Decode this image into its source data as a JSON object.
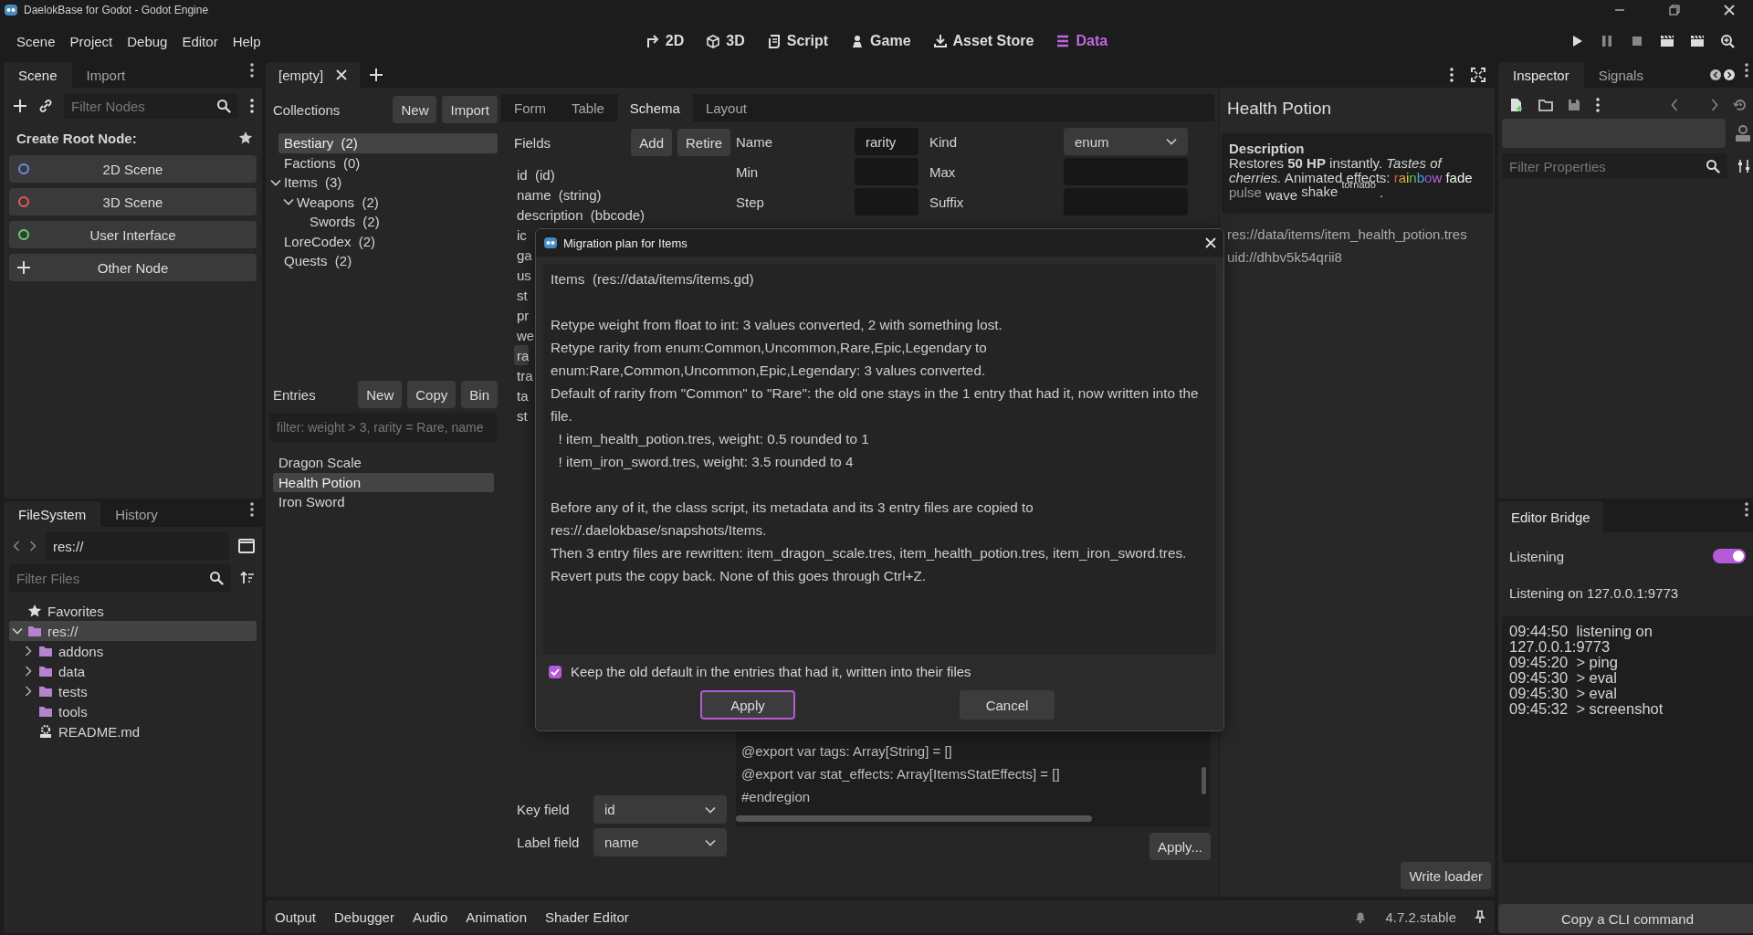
{
  "window": {
    "title": "DaelokBase for Godot - Godot Engine"
  },
  "menu": [
    "Scene",
    "Project",
    "Debug",
    "Editor",
    "Help"
  ],
  "workspaces": [
    {
      "label": "2D",
      "kind": "planar",
      "selected": false
    },
    {
      "label": "3D",
      "kind": "spatial",
      "selected": false
    },
    {
      "label": "Script",
      "kind": "script",
      "selected": false
    },
    {
      "label": "Game",
      "kind": "game",
      "selected": false
    },
    {
      "label": "Asset Store",
      "kind": "store",
      "selected": false
    },
    {
      "label": "Data",
      "kind": "data",
      "selected": true
    }
  ],
  "scene_dock": {
    "tabs": [
      {
        "label": "Scene",
        "selected": true
      },
      {
        "label": "Import",
        "selected": false
      }
    ],
    "filter": {
      "placeholder": "Filter Nodes"
    },
    "heading": "Create Root Node:",
    "buttons": [
      {
        "label": "2D Scene",
        "kind": "planar"
      },
      {
        "label": "3D Scene",
        "kind": "spatial"
      },
      {
        "label": "User Interface",
        "kind": "ui"
      },
      {
        "label": "Other Node",
        "kind": "other"
      }
    ]
  },
  "filesystem_dock": {
    "tabs": [
      {
        "label": "FileSystem",
        "selected": true
      },
      {
        "label": "History",
        "selected": false
      }
    ],
    "path": "res://",
    "filter": {
      "placeholder": "Filter Files"
    },
    "tree": [
      {
        "label": "Favorites",
        "kind": "favorites",
        "selected": false
      },
      {
        "label": "res://",
        "kind": "folder",
        "selected": true,
        "expanded": true,
        "children": [
          {
            "label": "addons",
            "kind": "folder",
            "selected": false,
            "expanded": false
          },
          {
            "label": "data",
            "kind": "folder",
            "selected": false,
            "expanded": false
          },
          {
            "label": "tests",
            "kind": "folder",
            "selected": false,
            "expanded": false
          },
          {
            "label": "tools",
            "kind": "folder",
            "selected": false
          },
          {
            "label": "README.md",
            "kind": "file",
            "selected": false
          }
        ]
      }
    ]
  },
  "scene_tabs": [
    "[empty]"
  ],
  "collections": {
    "title": "Collections",
    "buttons": [
      "New",
      "Import"
    ],
    "tree": [
      {
        "label": "Bestiary  (2)",
        "selected": true
      },
      {
        "label": "Factions  (0)",
        "selected": false
      },
      {
        "label": "Items  (3)",
        "selected": false,
        "expanded": true,
        "children": [
          {
            "label": "Weapons  (2)",
            "selected": false,
            "expanded": true,
            "children": [
              {
                "label": "Swords  (2)",
                "selected": false
              }
            ]
          }
        ]
      },
      {
        "label": "LoreCodex  (2)",
        "selected": false
      },
      {
        "label": "Quests  (2)",
        "selected": false
      }
    ]
  },
  "entries": {
    "title": "Entries",
    "buttons": [
      "New",
      "Copy",
      "Bin"
    ],
    "filter": {
      "placeholder": "filter: weight > 3, rarity = Rare, name"
    },
    "items": [
      {
        "label": "Dragon Scale",
        "selected": false
      },
      {
        "label": "Health Potion",
        "selected": true
      },
      {
        "label": "Iron Sword",
        "selected": false
      }
    ]
  },
  "schema": {
    "tabs": [
      {
        "label": "Form",
        "selected": false
      },
      {
        "label": "Table",
        "selected": false
      },
      {
        "label": "Schema",
        "selected": true
      },
      {
        "label": "Layout",
        "selected": false
      }
    ],
    "fields_title": "Fields",
    "buttons": [
      "Add",
      "Retire"
    ],
    "fields": [
      {
        "label": "id  (id)",
        "selected": false
      },
      {
        "label": "name  (string)",
        "selected": false
      },
      {
        "label": "description  (bbcode)",
        "selected": false
      },
      {
        "label": "ic",
        "selected": false
      },
      {
        "label": "ga",
        "selected": false
      },
      {
        "label": "us",
        "selected": false
      },
      {
        "label": "st",
        "selected": false
      },
      {
        "label": "pr",
        "selected": false
      },
      {
        "label": "we",
        "selected": false
      },
      {
        "label": "ra",
        "selected": true
      },
      {
        "label": "tra",
        "selected": false
      },
      {
        "label": "ta",
        "selected": false
      },
      {
        "label": "st",
        "selected": false
      }
    ],
    "properties": [
      {
        "label": "Name",
        "kind": "text",
        "value": "rarity"
      },
      {
        "label": "Kind",
        "kind": "select",
        "value": "enum"
      },
      {
        "label": "Min",
        "kind": "text"
      },
      {
        "label": "Max",
        "kind": "text"
      },
      {
        "label": "Step",
        "kind": "text"
      },
      {
        "label": "Suffix",
        "kind": "text"
      }
    ],
    "code": [
      "@export var tags: Array[String] = []",
      "@export var stat_effects: Array[ItemsStatEffects] = []",
      "#endregion"
    ],
    "key_field": {
      "label": "Key field",
      "value": "id"
    },
    "label_field": {
      "label": "Label field",
      "value": "name"
    },
    "apply_button": "Apply..."
  },
  "preview": {
    "title": "Health Potion",
    "description_label": "Description",
    "description": "Restores **50 HP** instantly. *Tastes of cherries.* Animated effects: ",
    "effects": [
      {
        "text": "rainbow",
        "kind": "rainbow"
      },
      {
        "text": "fade",
        "kind": "fade"
      },
      {
        "text": "pulse",
        "kind": "pulse"
      },
      {
        "text": "wave",
        "kind": "wave"
      },
      {
        "text": "shake",
        "kind": "shake"
      },
      {
        "text": "tornado",
        "kind": "tornado"
      }
    ],
    "description_end": ".",
    "path": "res://data/items/item_health_potion.tres",
    "uid": "uid://dhbv5k54qrii8",
    "write_loader_button": "Write loader"
  },
  "bottom_tabs": [
    "Output",
    "Debugger",
    "Audio",
    "Animation",
    "Shader Editor"
  ],
  "version": "4.7.2.stable",
  "inspector": {
    "tabs": [
      {
        "label": "Inspector",
        "selected": true
      },
      {
        "label": "Signals",
        "selected": false
      }
    ],
    "filter": {
      "placeholder": "Filter Properties"
    }
  },
  "bridge": {
    "tab": "Editor Bridge",
    "toggle": {
      "label": "Listening",
      "on": true
    },
    "status": "Listening on 127.0.0.1:9773",
    "log": [
      "09:44:50  listening on 127.0.0.1:9773",
      "09:45:20  > ping",
      "09:45:30  > eval",
      "09:45:30  > eval",
      "09:45:32  > screenshot"
    ],
    "button": "Copy a CLI command"
  },
  "dialog": {
    "title": "Migration plan for Items",
    "paragraphs": [
      [
        "Items  (res://data/items/items.gd)"
      ],
      [
        "Retype weight from float to int: 3 values converted, 2 with something lost.",
        "Retype rarity from enum:Common,Uncommon,Rare,Epic,Legendary to enum:Rare,Common,Uncommon,Epic,Legendary: 3 values converted.",
        "Default of rarity from \"Common\" to \"Rare\": the old one stays in the 1 entry that had it, now written into the file.",
        "  ! item_health_potion.tres, weight: 0.5 rounded to 1",
        "  ! item_iron_sword.tres, weight: 3.5 rounded to 4"
      ],
      [
        "Before any of it, the class script, its metadata and its 3 entry files are copied to res://.daelokbase/snapshots/Items.",
        "Then 3 entry files are rewritten: item_dragon_scale.tres, item_health_potion.tres, item_iron_sword.tres.",
        "Revert puts the copy back. None of this goes through Ctrl+Z."
      ]
    ],
    "checkbox": {
      "label": "Keep the old default in the entries that had it, written into their files",
      "checked": true
    },
    "buttons": [
      {
        "label": "Apply",
        "focused": true
      },
      {
        "label": "Cancel",
        "focused": false
      }
    ]
  }
}
